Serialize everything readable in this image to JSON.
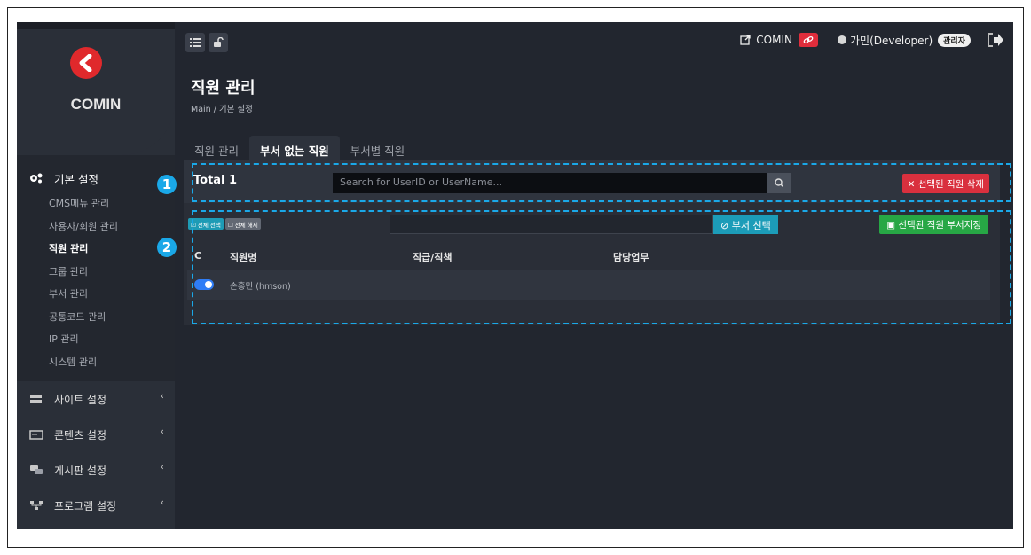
{
  "app": {
    "logo_text": "COMIN",
    "brand_color": "#e0292c"
  },
  "sidebar": {
    "group": {
      "label": "기본 설정",
      "icon": "gears-icon",
      "items": [
        {
          "label": "CMS메뉴 관리"
        },
        {
          "label": "사용자/회원 관리"
        },
        {
          "label": "직원 관리"
        },
        {
          "label": "그룹 관리"
        },
        {
          "label": "부서 관리"
        },
        {
          "label": "공통코드 관리"
        },
        {
          "label": "IP 관리"
        },
        {
          "label": "시스템 관리"
        }
      ],
      "active_index": 2
    },
    "menus": [
      {
        "label": "사이트 설정",
        "icon": "server-icon"
      },
      {
        "label": "콘텐츠 설정",
        "icon": "card-icon"
      },
      {
        "label": "게시판 설정",
        "icon": "chat-icon"
      },
      {
        "label": "프로그램 설정",
        "icon": "sitemap-icon"
      }
    ]
  },
  "header": {
    "site_label": "COMIN",
    "user_label": "가민(Developer)",
    "role_badge": "관리자"
  },
  "page": {
    "title": "직원 관리",
    "breadcrumb": "Main  /  기본 설정"
  },
  "tabs": [
    {
      "label": "직원 관리"
    },
    {
      "label": "부서 없는 직원"
    },
    {
      "label": "부서별 직원"
    }
  ],
  "toolbar": {
    "total": "Total 1",
    "search_placeholder": "Search for UserID or UserName...",
    "delete_label": "✕ 선택된 직원 삭제",
    "select_all": "☑ 전체 선택",
    "deselect_all": "☐ 전체 해제",
    "dept_select_label": "⊘ 부서 선택",
    "assign_label": "▣ 선택된 직원 부서지정"
  },
  "table": {
    "headers": [
      "C",
      "직원명",
      "직급/직책",
      "담당업무"
    ],
    "rows": [
      {
        "name": "손홍민 (hmson)",
        "rank": "",
        "duty": "",
        "selected": true
      }
    ]
  },
  "annotations": [
    "1",
    "2"
  ]
}
